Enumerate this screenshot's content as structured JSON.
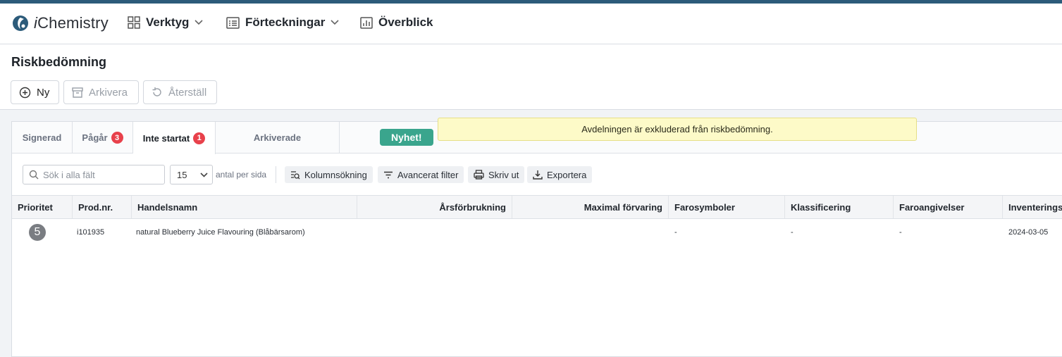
{
  "app": {
    "brand_prefix": "i",
    "brand_suffix": "Chemistry",
    "accent": "#2c5b7a"
  },
  "nav": {
    "items": [
      {
        "label": "Verktyg",
        "icon": "grid-icon",
        "dropdown": true
      },
      {
        "label": "Förteckningar",
        "icon": "list-icon",
        "dropdown": true
      },
      {
        "label": "Överblick",
        "icon": "chart-icon",
        "dropdown": false
      }
    ]
  },
  "page": {
    "title": "Riskbedömning"
  },
  "actions": {
    "new_label": "Ny",
    "archive_label": "Arkivera",
    "restore_label": "Återställ"
  },
  "tabs": [
    {
      "label": "Signerad",
      "badge": null,
      "active": false
    },
    {
      "label": "Pågår",
      "badge": "3",
      "active": false
    },
    {
      "label": "Inte startat",
      "badge": "1",
      "active": true
    },
    {
      "label": "Arkiverade",
      "badge": null,
      "active": false
    }
  ],
  "nyhet_label": "Nyhet!",
  "notice_text": "Avdelningen är exkluderad från riskbedömning.",
  "toolbar": {
    "search_placeholder": "Sök i alla fält",
    "per_page_value": "15",
    "per_page_label": "antal per sida",
    "column_search_label": "Kolumnsökning",
    "advanced_filter_label": "Avancerat filter",
    "print_label": "Skriv ut",
    "export_label": "Exportera"
  },
  "table": {
    "columns": [
      "Prioritet",
      "Prod.nr.",
      "Handelsnamn",
      "Årsförbrukning",
      "Maximal förvaring",
      "Farosymboler",
      "Klassificering",
      "Faroangivelser",
      "Inventeringse"
    ],
    "rows": [
      {
        "priority": "5",
        "prod_nr": "i101935",
        "trade_name": "natural Blueberry Juice Flavouring (Blåbärsarom)",
        "annual_use": "",
        "max_storage": "",
        "hazard_symbols": "-",
        "classification": "-",
        "hazard_statements": "-",
        "inventory_date": "2024-03-05"
      }
    ]
  }
}
